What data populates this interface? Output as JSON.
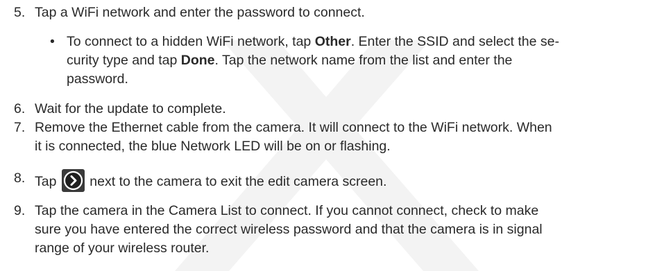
{
  "steps": [
    {
      "num": "5.",
      "text": "Tap a WiFi network and enter the password to connect."
    },
    {
      "bullet": "•",
      "line1": {
        "a": "To connect to a hidden WiFi network, tap ",
        "b": "Other",
        "c": ". Enter the SSID and select the se-"
      },
      "line2": {
        "a": "curity type and tap ",
        "b": "Done",
        "c": ". Tap the network name from the list and enter the"
      },
      "line3": "password."
    },
    {
      "num": "6.",
      "text": "Wait for the update to complete."
    },
    {
      "num": "7.",
      "line1": "Remove the Ethernet cable from the camera. It will connect to the WiFi network. When",
      "line2": "it is connected, the blue Network LED will be on or flashing."
    },
    {
      "num": "8.",
      "pre": "Tap",
      "post": "next to the camera to exit the edit camera screen.",
      "icon": "arrow-circle-icon"
    },
    {
      "num": "9.",
      "line1": "Tap the camera in the Camera List to connect. If you cannot connect, check to make",
      "line2": "sure you have entered the correct wireless password and that the camera is in signal",
      "line3": "range of your wireless router."
    }
  ],
  "colors": {
    "text": "#2a2a2a",
    "watermark": "#f4f4f4",
    "icon_bg": "#2b2b2b",
    "icon_fg": "#ffffff"
  }
}
